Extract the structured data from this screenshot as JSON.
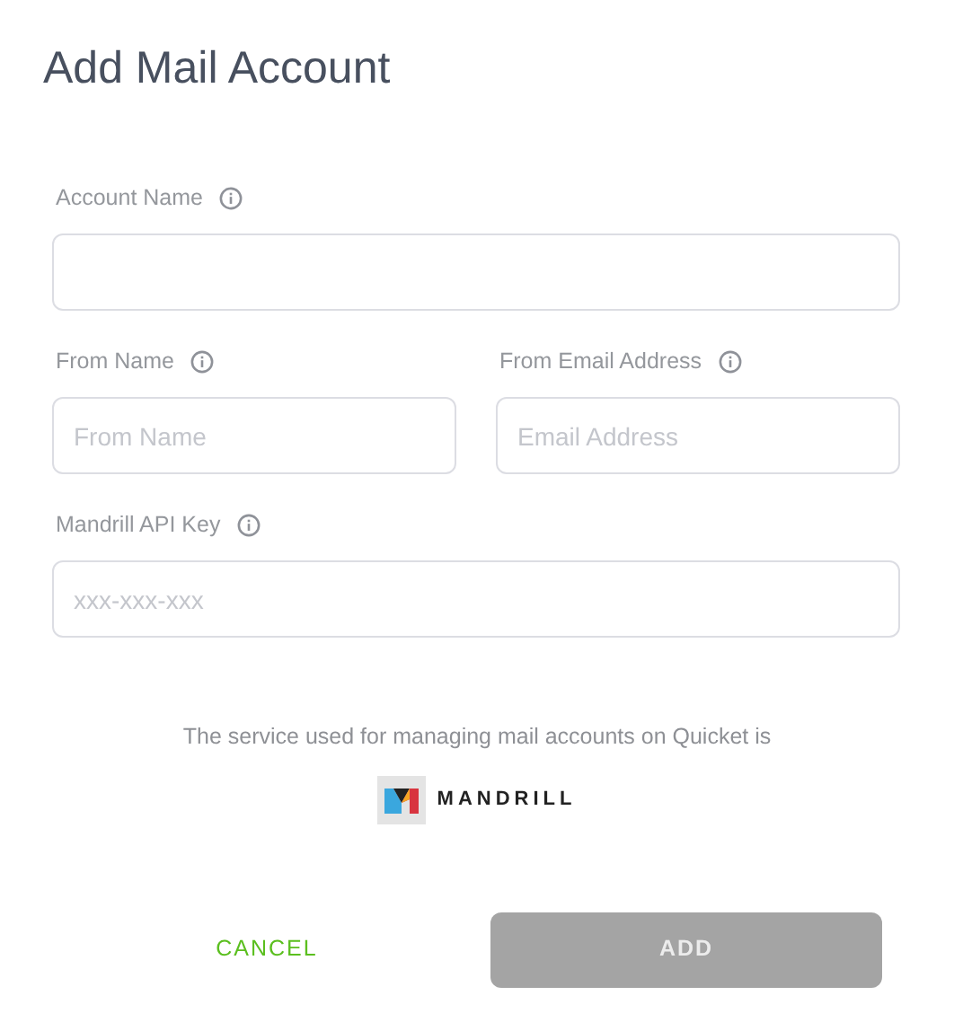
{
  "title": "Add Mail Account",
  "field_rows": [
    [
      {
        "label": "Account Name"
      }
    ],
    [
      {
        "label": "From Name",
        "placeholder": "From Name"
      },
      {
        "label": "From Email Address",
        "placeholder": "Email Address"
      }
    ],
    [
      {
        "label": "Mandrill API Key",
        "placeholder": "xxx-xxx-xxx"
      }
    ]
  ],
  "service_note": "The service used for managing mail accounts on Quicket is",
  "service_logo": {
    "name": "MANDRILL"
  },
  "buttons": [
    {
      "label": "CANCEL",
      "kind": "text",
      "disabled": false
    },
    {
      "label": "ADD",
      "kind": "primary",
      "disabled": true
    }
  ]
}
